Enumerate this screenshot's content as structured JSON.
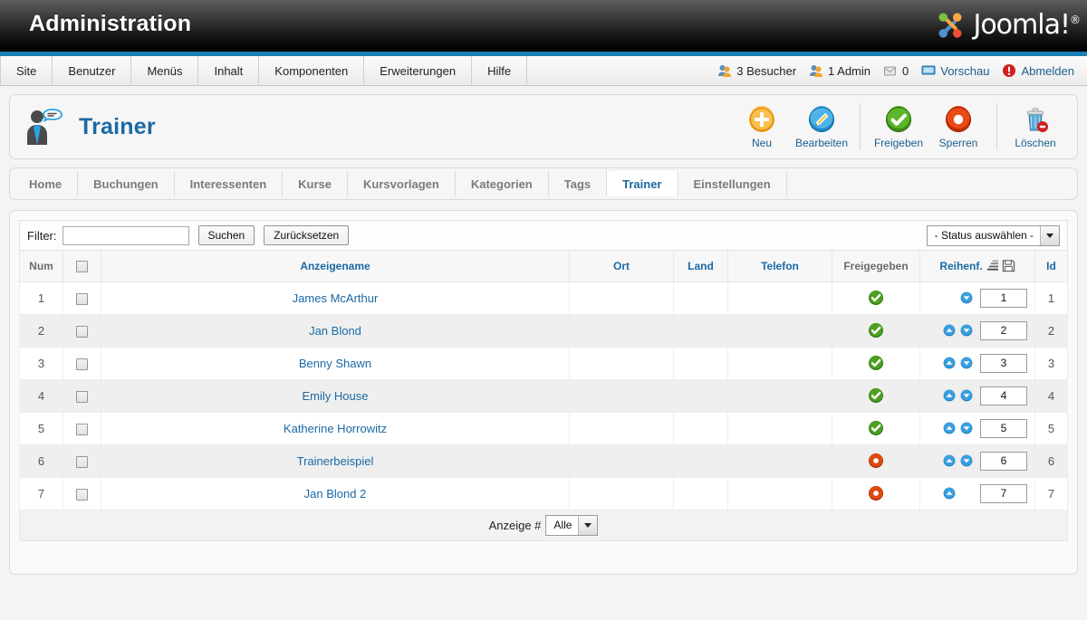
{
  "header": {
    "admin_title": "Administration",
    "brand": "Joomla!",
    "brand_sup": "®"
  },
  "menubar": {
    "items": [
      {
        "label": "Site"
      },
      {
        "label": "Benutzer"
      },
      {
        "label": "Menüs"
      },
      {
        "label": "Inhalt"
      },
      {
        "label": "Komponenten"
      },
      {
        "label": "Erweiterungen"
      },
      {
        "label": "Hilfe"
      }
    ],
    "status": {
      "visitors": "3 Besucher",
      "admins": "1 Admin",
      "messages": "0",
      "preview": "Vorschau",
      "logout": "Abmelden"
    }
  },
  "toolbar": {
    "page_title": "Trainer",
    "buttons": [
      {
        "label": "Neu",
        "icon": "plus-circle-icon"
      },
      {
        "label": "Bearbeiten",
        "icon": "pencil-circle-icon"
      },
      {
        "label": "Freigeben",
        "icon": "check-circle-icon"
      },
      {
        "label": "Sperren",
        "icon": "unpublish-circle-icon"
      },
      {
        "label": "Löschen",
        "icon": "trash-icon"
      }
    ]
  },
  "tabs": [
    {
      "label": "Home",
      "active": false
    },
    {
      "label": "Buchungen",
      "active": false
    },
    {
      "label": "Interessenten",
      "active": false
    },
    {
      "label": "Kurse",
      "active": false
    },
    {
      "label": "Kursvorlagen",
      "active": false
    },
    {
      "label": "Kategorien",
      "active": false
    },
    {
      "label": "Tags",
      "active": false
    },
    {
      "label": "Trainer",
      "active": true
    },
    {
      "label": "Einstellungen",
      "active": false
    }
  ],
  "filter": {
    "label": "Filter:",
    "value": "",
    "placeholder": "",
    "search_button": "Suchen",
    "reset_button": "Zurücksetzen",
    "status_select": "- Status auswählen -"
  },
  "table": {
    "columns": {
      "num": "Num",
      "checkbox": "",
      "name": "Anzeigename",
      "city": "Ort",
      "country": "Land",
      "phone": "Telefon",
      "published": "Freigegeben",
      "ordering": "Reihenf.",
      "id": "Id"
    },
    "rows": [
      {
        "num": "1",
        "name": "James McArthur",
        "city": "",
        "country": "",
        "phone": "",
        "published": "published",
        "order_value": "1",
        "up": false,
        "down": true,
        "id": "1"
      },
      {
        "num": "2",
        "name": "Jan Blond",
        "city": "",
        "country": "",
        "phone": "",
        "published": "published",
        "order_value": "2",
        "up": true,
        "down": true,
        "id": "2"
      },
      {
        "num": "3",
        "name": "Benny Shawn",
        "city": "",
        "country": "",
        "phone": "",
        "published": "published",
        "order_value": "3",
        "up": true,
        "down": true,
        "id": "3"
      },
      {
        "num": "4",
        "name": "Emily House",
        "city": "",
        "country": "",
        "phone": "",
        "published": "published",
        "order_value": "4",
        "up": true,
        "down": true,
        "id": "4"
      },
      {
        "num": "5",
        "name": "Katherine Horrowitz",
        "city": "",
        "country": "",
        "phone": "",
        "published": "published",
        "order_value": "5",
        "up": true,
        "down": true,
        "id": "5"
      },
      {
        "num": "6",
        "name": "Trainerbeispiel",
        "city": "",
        "country": "",
        "phone": "",
        "published": "unpublished",
        "order_value": "6",
        "up": true,
        "down": true,
        "id": "6"
      },
      {
        "num": "7",
        "name": "Jan Blond 2",
        "city": "",
        "country": "",
        "phone": "",
        "published": "unpublished",
        "order_value": "7",
        "up": true,
        "down": false,
        "id": "7"
      }
    ]
  },
  "footer": {
    "display_label": "Anzeige #",
    "display_value": "Alle"
  },
  "colors": {
    "link_blue": "#1a69a4",
    "accent_blue": "#1b7fb5",
    "published_green": "#3f9a20",
    "unpublished_red": "#d93a07",
    "new_orange": "#f6a01a"
  }
}
